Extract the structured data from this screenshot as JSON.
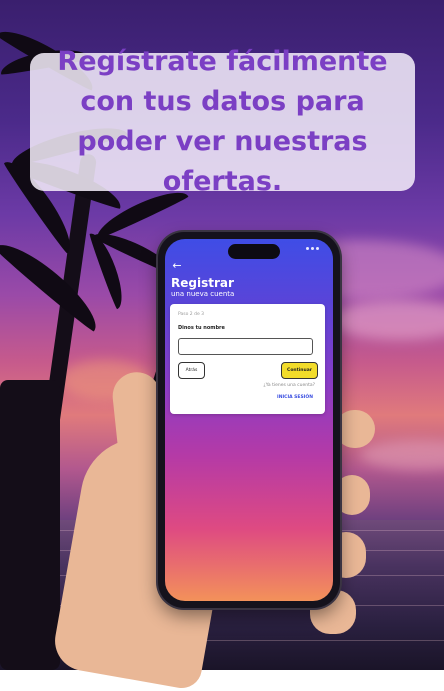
{
  "banner": {
    "headline": "Regístrate fácilmente con tus datos para poder ver nuestras ofertas."
  },
  "app": {
    "back_icon": "arrow-left-icon",
    "title": "Registrar",
    "subtitle": "una nueva cuenta",
    "form": {
      "step": "Paso 2 de 3",
      "field_label": "Dinos tu nombre",
      "name_value": "",
      "back_button": "Atrás",
      "continue_button": "Continuar",
      "has_account_text": "¿Ya tienes una cuenta?",
      "login_link": "INICIA SESIÓN"
    }
  },
  "colors": {
    "banner_text": "#7b3fc4",
    "continue_button": "#f2dc2a",
    "login_link": "#3a4ee0"
  }
}
